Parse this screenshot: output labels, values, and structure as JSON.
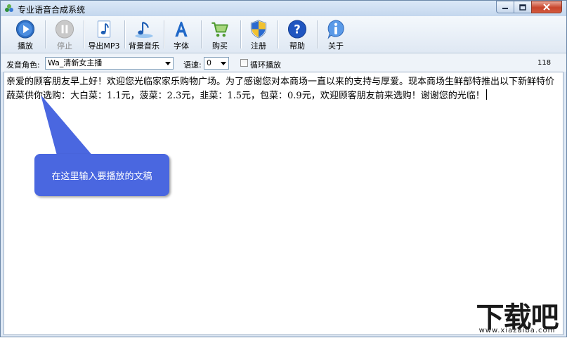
{
  "window": {
    "title": "专业语音合成系统",
    "controls": {
      "minimize": "minimize",
      "maximize": "maximize",
      "close": "close"
    }
  },
  "toolbar": {
    "buttons": [
      {
        "label": "播放",
        "icon": "play-icon",
        "enabled": true
      },
      {
        "label": "停止",
        "icon": "pause-icon",
        "enabled": false
      },
      {
        "label": "导出MP3",
        "icon": "music-note-icon",
        "enabled": true
      },
      {
        "label": "背景音乐",
        "icon": "music-notes-icon",
        "enabled": true
      },
      {
        "label": "字体",
        "icon": "font-icon",
        "enabled": true
      },
      {
        "label": "购买",
        "icon": "cart-icon",
        "enabled": true
      },
      {
        "label": "注册",
        "icon": "shield-icon",
        "enabled": true
      },
      {
        "label": "帮助",
        "icon": "help-icon",
        "enabled": true
      },
      {
        "label": "关于",
        "icon": "info-icon",
        "enabled": true
      }
    ]
  },
  "options": {
    "voice_label": "发音角色:",
    "voice_value": "Wa_清新女主播",
    "speed_label": "语速:",
    "speed_value": "0",
    "loop_label": "循环播放",
    "loop_checked": false,
    "char_count": "118"
  },
  "editor": {
    "text": "亲爱的顾客朋友早上好！欢迎您光临家家乐购物广场。为了感谢您对本商场一直以来的支持与厚爱。现本商场生鲜部特推出以下新鲜特价蔬菜供你选购：大白菜：1.1元，菠菜：2.3元，韭菜：1.5元，包菜：0.9元，欢迎顾客朋友前来选购！谢谢您的光临！"
  },
  "callout": {
    "text": "在这里输入要播放的文稿",
    "color": "#4a67e0"
  },
  "watermark": {
    "big": "下载吧",
    "small": "www.xiazaiba.com"
  },
  "colors": {
    "accent": "#3a7bd5",
    "window_bg": "#dfe9f5"
  }
}
